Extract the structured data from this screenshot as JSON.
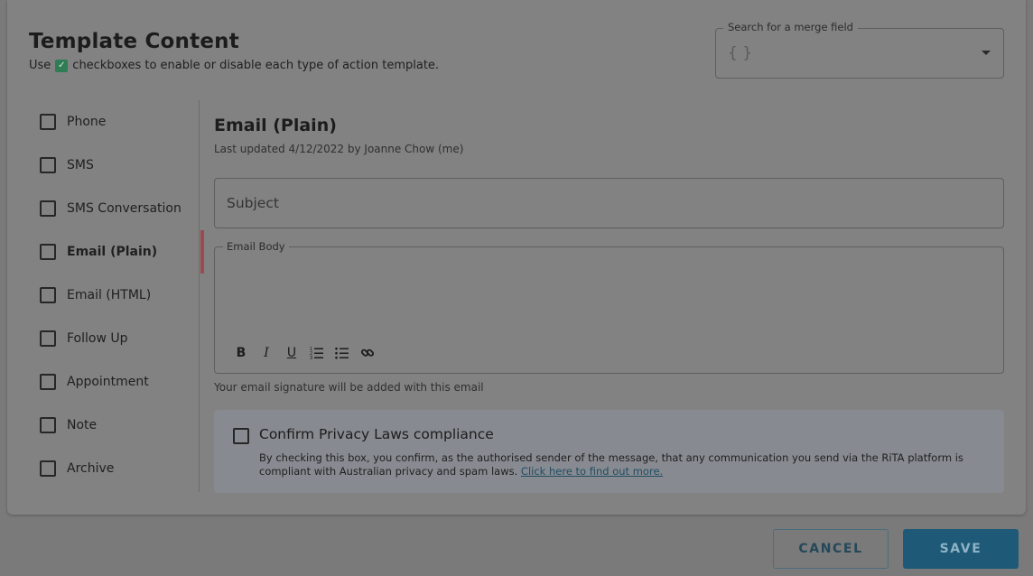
{
  "header": {
    "title": "Template Content",
    "subtitle_before": "Use",
    "subtitle_after": "checkboxes to enable or disable each type of action template."
  },
  "merge_field": {
    "label": "Search for a merge field",
    "placeholder": "{ }"
  },
  "sidebar": {
    "items": [
      {
        "label": "Phone"
      },
      {
        "label": "SMS"
      },
      {
        "label": "SMS Conversation"
      },
      {
        "label": "Email (Plain)"
      },
      {
        "label": "Email (HTML)"
      },
      {
        "label": "Follow Up"
      },
      {
        "label": "Appointment"
      },
      {
        "label": "Note"
      },
      {
        "label": "Archive"
      }
    ],
    "active": "Email (Plain)"
  },
  "editor": {
    "heading": "Email (Plain)",
    "updated": "Last updated 4/12/2022 by Joanne Chow (me)",
    "subject_placeholder": "Subject",
    "body_label": "Email Body",
    "toolbar": {
      "bold": "B",
      "italic": "I",
      "underline": "U"
    },
    "signature_note": "Your email signature will be added with this email"
  },
  "privacy": {
    "title": "Confirm Privacy Laws compliance",
    "text": "By checking this box, you confirm, as the authorised sender of the message, that any communication you send via the RiTA platform is compliant with Australian privacy and spam laws.",
    "link": "Click here to find out more."
  },
  "actions": {
    "cancel": "CANCEL",
    "save": "SAVE"
  }
}
